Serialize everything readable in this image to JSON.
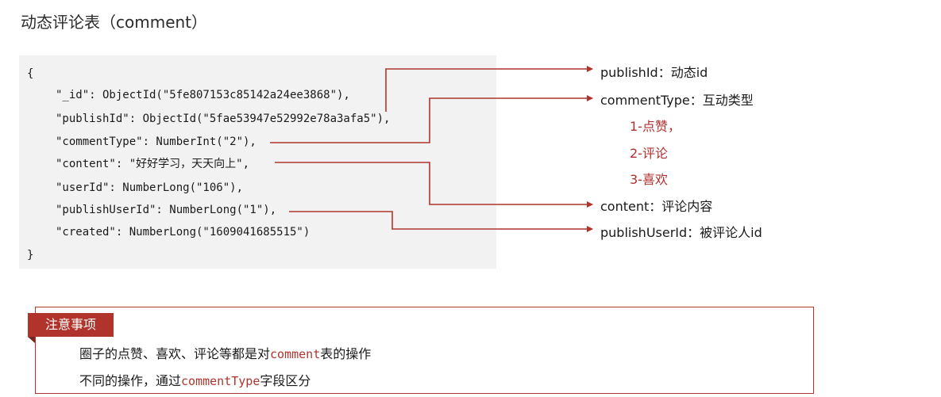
{
  "title": "动态评论表（comment）",
  "code": {
    "open": "{",
    "close": "}",
    "lines": [
      "\"_id\": ObjectId(\"5fe807153c85142a24ee3868\"),",
      "\"publishId\": ObjectId(\"5fae53947e52992e78a3afa5\"),",
      "\"commentType\": NumberInt(\"2\"),",
      "\"content\": \"好好学习，天天向上\",",
      "\"userId\": NumberLong(\"106\"),",
      "\"publishUserId\": NumberLong(\"1\"),",
      "\"created\": NumberLong(\"1609041685515\")"
    ]
  },
  "annotations": {
    "publishId": "publishId：动态id",
    "commentType": "commentType：互动类型",
    "comment_type_values": [
      "1-点赞，",
      "2-评论",
      "3-喜欢"
    ],
    "content": "content：评论内容",
    "publishUserId": "publishUserId：被评论人id"
  },
  "note": {
    "tag": "注意事项",
    "line1_prefix": "圈子的点赞、喜欢、评论等都是对",
    "line1_code": "comment",
    "line1_suffix": "表的操作",
    "line2_prefix": "不同的操作，通过",
    "line2_code": "commentType",
    "line2_suffix": "字段区分"
  },
  "colors": {
    "accent": "#b0342c",
    "code_bg": "#f2f2f2"
  }
}
